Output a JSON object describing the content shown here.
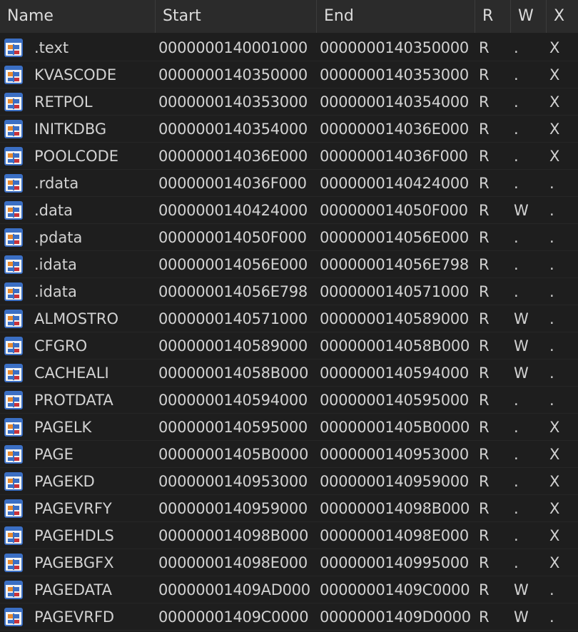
{
  "columns": {
    "name": "Name",
    "start": "Start",
    "end": "End",
    "r": "R",
    "w": "W",
    "x": "X"
  },
  "rows": [
    {
      "name": ".text",
      "start": "0000000140001000",
      "end": "0000000140350000",
      "r": "R",
      "w": ".",
      "x": "X"
    },
    {
      "name": "KVASCODE",
      "start": "0000000140350000",
      "end": "0000000140353000",
      "r": "R",
      "w": ".",
      "x": "X"
    },
    {
      "name": "RETPOL",
      "start": "0000000140353000",
      "end": "0000000140354000",
      "r": "R",
      "w": ".",
      "x": "X"
    },
    {
      "name": "INITKDBG",
      "start": "0000000140354000",
      "end": "000000014036E000",
      "r": "R",
      "w": ".",
      "x": "X"
    },
    {
      "name": "POOLCODE",
      "start": "000000014036E000",
      "end": "000000014036F000",
      "r": "R",
      "w": ".",
      "x": "X"
    },
    {
      "name": ".rdata",
      "start": "000000014036F000",
      "end": "0000000140424000",
      "r": "R",
      "w": ".",
      "x": "."
    },
    {
      "name": ".data",
      "start": "0000000140424000",
      "end": "000000014050F000",
      "r": "R",
      "w": "W",
      "x": "."
    },
    {
      "name": ".pdata",
      "start": "000000014050F000",
      "end": "000000014056E000",
      "r": "R",
      "w": ".",
      "x": "."
    },
    {
      "name": ".idata",
      "start": "000000014056E000",
      "end": "000000014056E798",
      "r": "R",
      "w": ".",
      "x": "."
    },
    {
      "name": ".idata",
      "start": "000000014056E798",
      "end": "0000000140571000",
      "r": "R",
      "w": ".",
      "x": "."
    },
    {
      "name": "ALMOSTRO",
      "start": "0000000140571000",
      "end": "0000000140589000",
      "r": "R",
      "w": "W",
      "x": "."
    },
    {
      "name": "CFGRO",
      "start": "0000000140589000",
      "end": "000000014058B000",
      "r": "R",
      "w": "W",
      "x": "."
    },
    {
      "name": "CACHEALI",
      "start": "000000014058B000",
      "end": "0000000140594000",
      "r": "R",
      "w": "W",
      "x": "."
    },
    {
      "name": "PROTDATA",
      "start": "0000000140594000",
      "end": "0000000140595000",
      "r": "R",
      "w": ".",
      "x": "."
    },
    {
      "name": "PAGELK",
      "start": "0000000140595000",
      "end": "00000001405B0000",
      "r": "R",
      "w": ".",
      "x": "X"
    },
    {
      "name": "PAGE",
      "start": "00000001405B0000",
      "end": "0000000140953000",
      "r": "R",
      "w": ".",
      "x": "X"
    },
    {
      "name": "PAGEKD",
      "start": "0000000140953000",
      "end": "0000000140959000",
      "r": "R",
      "w": ".",
      "x": "X"
    },
    {
      "name": "PAGEVRFY",
      "start": "0000000140959000",
      "end": "000000014098B000",
      "r": "R",
      "w": ".",
      "x": "X"
    },
    {
      "name": "PAGEHDLS",
      "start": "000000014098B000",
      "end": "000000014098E000",
      "r": "R",
      "w": ".",
      "x": "X"
    },
    {
      "name": "PAGEBGFX",
      "start": "000000014098E000",
      "end": "0000000140995000",
      "r": "R",
      "w": ".",
      "x": "X"
    },
    {
      "name": "PAGEDATA",
      "start": "00000001409AD000",
      "end": "00000001409C0000",
      "r": "R",
      "w": "W",
      "x": "."
    },
    {
      "name": "PAGEVRFD",
      "start": "00000001409C0000",
      "end": "00000001409D0000",
      "r": "R",
      "w": "W",
      "x": "."
    }
  ],
  "row_icon": "segment-icon",
  "colors": {
    "background": "#1e1e1e",
    "header": "#2b2b2b",
    "text": "#d2d2d2",
    "icon_blue": "#3b6fc4",
    "icon_orange": "#e8892e",
    "icon_red": "#c9333a"
  }
}
